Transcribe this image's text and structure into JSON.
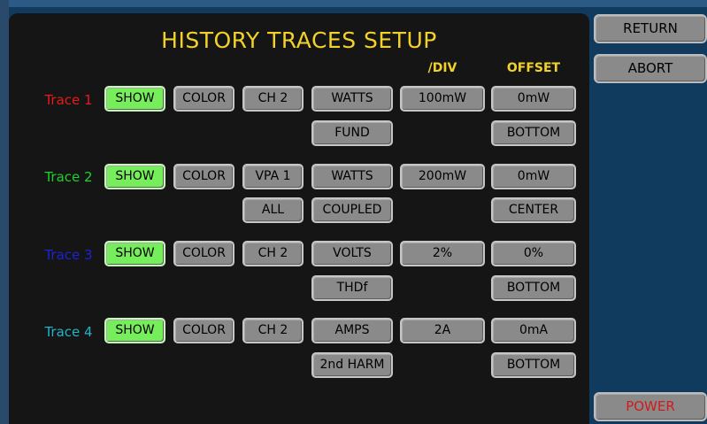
{
  "title": "HISTORY TRACES SETUP",
  "headers": {
    "per_div": "/DIV",
    "offset": "OFFSET"
  },
  "side": {
    "return": "RETURN",
    "abort": "ABORT",
    "power": "POWER"
  },
  "colors": {
    "title": "#f2d22a",
    "show": "#76ee5b",
    "button": "#8a8a8a",
    "panel": "#151515",
    "background": "#103a5e"
  },
  "traces": [
    {
      "label": "Trace 1",
      "color": "#e8191c",
      "show": "SHOW",
      "color_btn": "COLOR",
      "source": "CH 2",
      "measure": "WATTS",
      "measure_sub": "FUND",
      "per_div": "100mW",
      "offset": "0mW",
      "offset_pos": "BOTTOM"
    },
    {
      "label": "Trace 2",
      "color": "#1fd12a",
      "show": "SHOW",
      "color_btn": "COLOR",
      "source": "VPA 1",
      "source_sub": "ALL",
      "measure": "WATTS",
      "measure_sub": "COUPLED",
      "per_div": "200mW",
      "offset": "0mW",
      "offset_pos": "CENTER"
    },
    {
      "label": "Trace 3",
      "color": "#1b23d6",
      "show": "SHOW",
      "color_btn": "COLOR",
      "source": "CH 2",
      "measure": "VOLTS",
      "measure_sub": "THDf",
      "per_div": "2%",
      "offset": "0%",
      "offset_pos": "BOTTOM"
    },
    {
      "label": "Trace 4",
      "color": "#23b3c4",
      "show": "SHOW",
      "color_btn": "COLOR",
      "source": "CH 2",
      "measure": "AMPS",
      "measure_sub": "2nd HARM",
      "per_div": "2A",
      "offset": "0mA",
      "offset_pos": "BOTTOM"
    }
  ]
}
